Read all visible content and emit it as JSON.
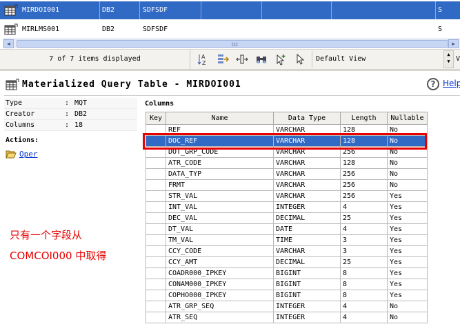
{
  "objects": [
    {
      "name": "MIRDOI001",
      "schema": "DB2",
      "creator": "SDFSDF",
      "flag": "S",
      "selected": true
    },
    {
      "name": "MIRLMS001",
      "schema": "DB2",
      "creator": "SDFSDF",
      "flag": "S",
      "selected": false
    }
  ],
  "scroll_grip": "III",
  "toolbar": {
    "status": "7 of 7 items displayed",
    "view": "Default View",
    "view_tail": "V",
    "icons": [
      "sort-az-icon",
      "filter-icon",
      "columns-icon",
      "binoculars-icon",
      "pointer-plus-icon",
      "pointer-icon"
    ]
  },
  "header": {
    "title": "Materialized Query Table - MIRDOI001",
    "help_label": "Help",
    "help_glyph": "?"
  },
  "properties": [
    {
      "key": "Type",
      "value": "MQT"
    },
    {
      "key": "Creator",
      "value": "DB2"
    },
    {
      "key": "Columns",
      "value": "18"
    }
  ],
  "prop_colon": ":",
  "actions": {
    "title": "Actions:",
    "oper_label": "Oper"
  },
  "annotation": {
    "line1": "只有一个字段从",
    "line2": "COMCOI000 中取得"
  },
  "columns_title": "Columns",
  "table": {
    "headers": [
      "Key",
      "Name",
      "Data Type",
      "Length",
      "Nullable"
    ],
    "rows": [
      {
        "key": "",
        "name": "REF",
        "type": "VARCHAR",
        "length": "128",
        "nullable": "No",
        "selected": false
      },
      {
        "key": "",
        "name": "DOC_REF",
        "type": "VARCHAR",
        "length": "128",
        "nullable": "No",
        "selected": true
      },
      {
        "key": "",
        "name": "DOT_GRP_CODE",
        "type": "VARCHAR",
        "length": "256",
        "nullable": "No",
        "selected": false
      },
      {
        "key": "",
        "name": "ATR_CODE",
        "type": "VARCHAR",
        "length": "128",
        "nullable": "No",
        "selected": false
      },
      {
        "key": "",
        "name": "DATA_TYP",
        "type": "VARCHAR",
        "length": "256",
        "nullable": "No",
        "selected": false
      },
      {
        "key": "",
        "name": "FRMT",
        "type": "VARCHAR",
        "length": "256",
        "nullable": "No",
        "selected": false
      },
      {
        "key": "",
        "name": "STR_VAL",
        "type": "VARCHAR",
        "length": "256",
        "nullable": "Yes",
        "selected": false
      },
      {
        "key": "",
        "name": "INT_VAL",
        "type": "INTEGER",
        "length": "4",
        "nullable": "Yes",
        "selected": false
      },
      {
        "key": "",
        "name": "DEC_VAL",
        "type": "DECIMAL",
        "length": "25",
        "nullable": "Yes",
        "selected": false
      },
      {
        "key": "",
        "name": "DT_VAL",
        "type": "DATE",
        "length": "4",
        "nullable": "Yes",
        "selected": false
      },
      {
        "key": "",
        "name": "TM_VAL",
        "type": "TIME",
        "length": "3",
        "nullable": "Yes",
        "selected": false
      },
      {
        "key": "",
        "name": "CCY_CODE",
        "type": "VARCHAR",
        "length": "3",
        "nullable": "Yes",
        "selected": false
      },
      {
        "key": "",
        "name": "CCY_AMT",
        "type": "DECIMAL",
        "length": "25",
        "nullable": "Yes",
        "selected": false
      },
      {
        "key": "",
        "name": "COADR000_IPKEY",
        "type": "BIGINT",
        "length": "8",
        "nullable": "Yes",
        "selected": false
      },
      {
        "key": "",
        "name": "CONAM000_IPKEY",
        "type": "BIGINT",
        "length": "8",
        "nullable": "Yes",
        "selected": false
      },
      {
        "key": "",
        "name": "COPHO000_IPKEY",
        "type": "BIGINT",
        "length": "8",
        "nullable": "Yes",
        "selected": false
      },
      {
        "key": "",
        "name": "ATR_GRP_SEQ",
        "type": "INTEGER",
        "length": "4",
        "nullable": "No",
        "selected": false
      },
      {
        "key": "",
        "name": "ATR_SEQ",
        "type": "INTEGER",
        "length": "4",
        "nullable": "No",
        "selected": false
      }
    ]
  },
  "colors": {
    "selection": "#316ac5",
    "annotation": "#e80000",
    "link": "#0033cc"
  }
}
